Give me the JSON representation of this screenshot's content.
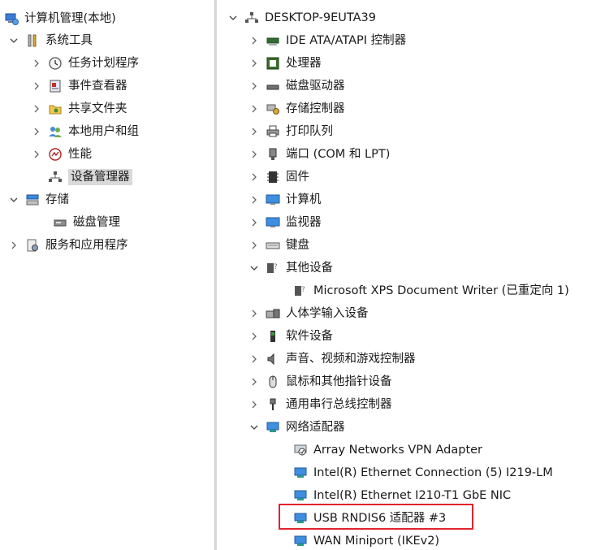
{
  "left_tree": {
    "root": "计算机管理(本地)",
    "system_tools": "系统工具",
    "task_scheduler": "任务计划程序",
    "event_viewer": "事件查看器",
    "shared_folders": "共享文件夹",
    "local_users": "本地用户和组",
    "performance": "性能",
    "device_manager": "设备管理器",
    "storage": "存储",
    "disk_management": "磁盘管理",
    "services_apps": "服务和应用程序"
  },
  "right_tree": {
    "computer": "DESKTOP-9EUTA39",
    "ide": "IDE ATA/ATAPI 控制器",
    "processor": "处理器",
    "disk_drives": "磁盘驱动器",
    "storage_ctrl": "存储控制器",
    "print_queue": "打印队列",
    "ports": "端口 (COM 和 LPT)",
    "firmware": "固件",
    "computer_node": "计算机",
    "monitors": "监视器",
    "keyboard": "键盘",
    "other_devices": "其他设备",
    "xps_writer": "Microsoft XPS Document Writer (已重定向 1)",
    "hid": "人体学输入设备",
    "software_devices": "软件设备",
    "sound": "声音、视频和游戏控制器",
    "mice": "鼠标和其他指针设备",
    "usb": "通用串行总线控制器",
    "network_adapters": "网络适配器",
    "array_vpn": "Array Networks VPN Adapter",
    "intel_i219": "Intel(R) Ethernet Connection (5) I219-LM",
    "intel_i210": "Intel(R) Ethernet I210-T1 GbE NIC",
    "usb_rndis": "USB RNDIS6 适配器 #3",
    "wan_ikev2": "WAN Miniport (IKEv2)"
  },
  "colors": {
    "highlight_box": "#e0232e",
    "selected_bg": "#d9d9d9"
  }
}
